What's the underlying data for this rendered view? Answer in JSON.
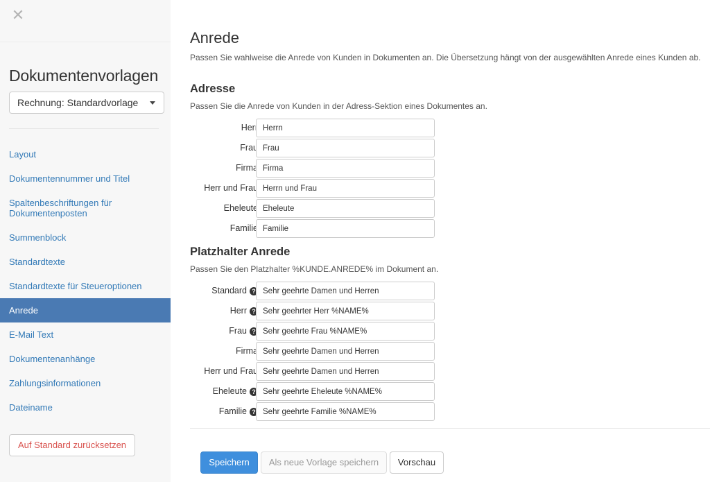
{
  "sidebar": {
    "close_symbol": "✕",
    "title": "Dokumentenvorlagen",
    "template_select": {
      "value": "Rechnung: Standardvorlage"
    },
    "items": [
      {
        "label": "Layout"
      },
      {
        "label": "Dokumentennummer und Titel"
      },
      {
        "label": "Spaltenbeschriftungen für Dokumentenposten"
      },
      {
        "label": "Summenblock"
      },
      {
        "label": "Standardtexte"
      },
      {
        "label": "Standardtexte für Steueroptionen"
      },
      {
        "label": "Anrede"
      },
      {
        "label": "E-Mail Text"
      },
      {
        "label": "Dokumentenanhänge"
      },
      {
        "label": "Zahlungsinformationen"
      },
      {
        "label": "Dateiname"
      }
    ],
    "active_index": 6,
    "reset_label": "Auf Standard zurücksetzen"
  },
  "main": {
    "title": "Anrede",
    "description": "Passen Sie wahlweise die Anrede von Kunden in Dokumenten an. Die Übersetzung hängt von der ausgewählten Anrede eines Kunden ab.",
    "address": {
      "title": "Adresse",
      "description": "Passen Sie die Anrede von Kunden in der Adress-Sektion eines Dokumentes an.",
      "fields": [
        {
          "label": "Herr",
          "value": "Herrn",
          "help": false
        },
        {
          "label": "Frau",
          "value": "Frau",
          "help": false
        },
        {
          "label": "Firma",
          "value": "Firma",
          "help": false
        },
        {
          "label": "Herr und Frau",
          "value": "Herrn und Frau",
          "help": false
        },
        {
          "label": "Eheleute",
          "value": "Eheleute",
          "help": false
        },
        {
          "label": "Familie",
          "value": "Familie",
          "help": false
        }
      ]
    },
    "placeholder": {
      "title": "Platzhalter Anrede",
      "description": "Passen Sie den Platzhalter %KUNDE.ANREDE% im Dokument an.",
      "fields": [
        {
          "label": "Standard",
          "value": "Sehr geehrte Damen und Herren",
          "help": true
        },
        {
          "label": "Herr",
          "value": "Sehr geehrter Herr %NAME%",
          "help": true
        },
        {
          "label": "Frau",
          "value": "Sehr geehrte Frau %NAME%",
          "help": true
        },
        {
          "label": "Firma",
          "value": "Sehr geehrte Damen und Herren",
          "help": false
        },
        {
          "label": "Herr und Frau",
          "value": "Sehr geehrte Damen und Herren",
          "help": false
        },
        {
          "label": "Eheleute",
          "value": "Sehr geehrte Eheleute %NAME%",
          "help": true
        },
        {
          "label": "Familie",
          "value": "Sehr geehrte Familie %NAME%",
          "help": true
        }
      ]
    },
    "help_symbol": "?",
    "buttons": {
      "save": "Speichern",
      "save_as_new": "Als neue Vorlage speichern",
      "preview": "Vorschau"
    }
  },
  "colors": {
    "link": "#337ab7",
    "active_nav": "#4a7ab3",
    "primary_button": "#3f8fdd",
    "reset_text": "#d9534f"
  },
  "icons": [
    "close-icon",
    "chevron-down-icon",
    "help-icon"
  ]
}
